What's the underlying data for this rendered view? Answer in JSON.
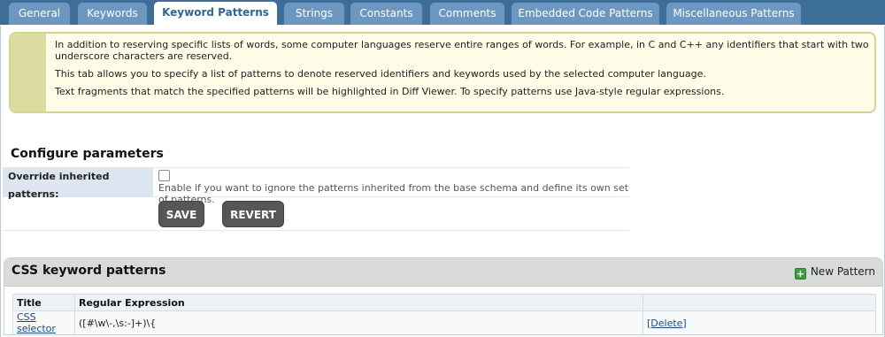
{
  "tabs": [
    {
      "label": "General",
      "active": false
    },
    {
      "label": "Keywords",
      "active": false
    },
    {
      "label": "Keyword Patterns",
      "active": true
    },
    {
      "label": "Strings",
      "active": false
    },
    {
      "label": "Constants",
      "active": false
    },
    {
      "label": "Comments",
      "active": false
    },
    {
      "label": "Embedded Code Patterns",
      "active": false
    },
    {
      "label": "Miscellaneous Patterns",
      "active": false
    }
  ],
  "info": {
    "p1": "In addition to reserving specific lists of words, some computer languages reserve entire ranges of words. For example, in C and C++ any identifiers that start with two underscore characters are reserved.",
    "p2": "This tab allows you to specify a list of patterns to denote reserved identifiers and keywords used by the selected computer language.",
    "p3": "Text fragments that match the specified patterns will be highlighted in Diff Viewer. To specify patterns use Java-style regular expressions."
  },
  "configure": {
    "title": "Configure parameters",
    "override_label": "Override inherited patterns:",
    "override_hint": "Enable if you want to ignore the patterns inherited from the base schema and define its own set of patterns.",
    "override_checked": false,
    "save_label": "SAVE",
    "revert_label": "REVERT"
  },
  "patterns_panel": {
    "title": "CSS keyword patterns",
    "new_label": "New Pattern",
    "columns": [
      "Title",
      "Regular Expression",
      ""
    ],
    "rows": [
      {
        "title": "CSS selector",
        "regex": "([#\\w\\-,\\s:-]+)\\{",
        "action": "[Delete]"
      }
    ]
  },
  "colors": {
    "tabbar_bg": "#3d6e9a",
    "tab_bg": "#6b97c1",
    "active_tab_text": "#2d6796",
    "info_bg": "#fefde8",
    "info_border": "#d6d48e",
    "button_bg": "#555855"
  }
}
